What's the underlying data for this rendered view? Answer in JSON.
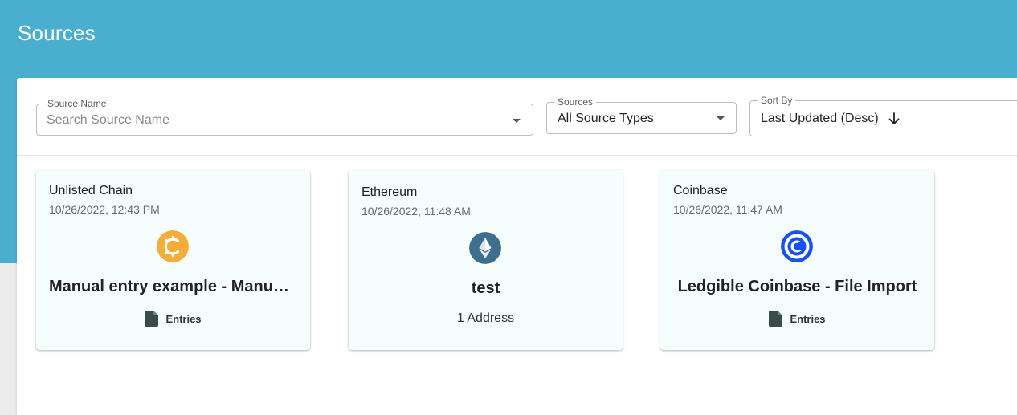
{
  "page": {
    "title": "Sources"
  },
  "filters": {
    "source_name": {
      "label": "Source Name",
      "placeholder": "Search Source Name",
      "value": ""
    },
    "sources": {
      "label": "Sources",
      "value": "All Source Types"
    },
    "sort_by": {
      "label": "Sort By",
      "value": "Last Updated (Desc)"
    }
  },
  "cards": [
    {
      "chain": "Unlisted Chain",
      "date": "10/26/2022, 12:43 PM",
      "icon": "unlisted-chain-icon",
      "name": "Manual entry example - Manual Entry",
      "action": "Entries"
    },
    {
      "chain": "Ethereum",
      "date": "10/26/2022, 11:48 AM",
      "icon": "ethereum-icon",
      "name": "test",
      "detail": "1 Address"
    },
    {
      "chain": "Coinbase",
      "date": "10/26/2022, 11:47 AM",
      "icon": "coinbase-icon",
      "name": "Ledgible Coinbase - File Import",
      "action": "Entries"
    }
  ],
  "colors": {
    "header": "#4aafce",
    "unlisted_icon": "#f5ac38",
    "ethereum_icon": "#3f6f8f",
    "coinbase_icon": "#1652f0"
  }
}
